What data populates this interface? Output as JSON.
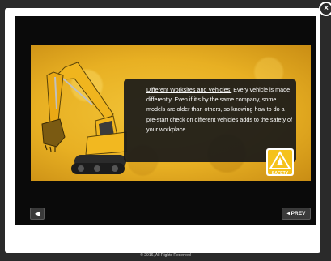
{
  "controls": {
    "close_glyph": "×",
    "sound_glyph": "◀",
    "prev_label": "◂ PREV"
  },
  "slide": {
    "heading": "Different Worksites and Vehicles:",
    "body": " Every vehicle is made differently. Even if it's by the same company, some models are older than others, so knowing how to do a pre-start check on different vehicles adds to the safety of your workplace.",
    "badge_text": "SAFETY"
  },
  "footer": {
    "text": "© 2016, All Rights Reserved"
  },
  "colors": {
    "backdrop": "#0a0a0a",
    "scene_yellow": "#e8b023",
    "excavator_yellow": "#f0b51e"
  },
  "icons": {
    "close": "close-icon",
    "sound": "speaker-icon",
    "badge": "safety-sign-icon"
  }
}
